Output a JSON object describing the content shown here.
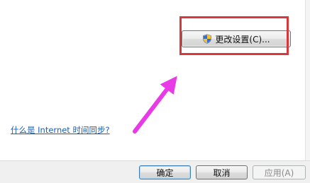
{
  "dialog": {
    "change_settings_label": "更改设置(C)...",
    "internet_time_link": "什么是 Internet 时间同步?"
  },
  "footer": {
    "ok_label": "确定",
    "cancel_label": "取消",
    "apply_label": "应用(A)"
  },
  "icons": {
    "uac_shield": "uac-shield-icon",
    "annotation_arrow": "pointer-arrow-icon"
  },
  "colors": {
    "highlight_box": "#d8383a",
    "annotation_arrow": "#e83ae6",
    "link": "#1a5fb4"
  }
}
